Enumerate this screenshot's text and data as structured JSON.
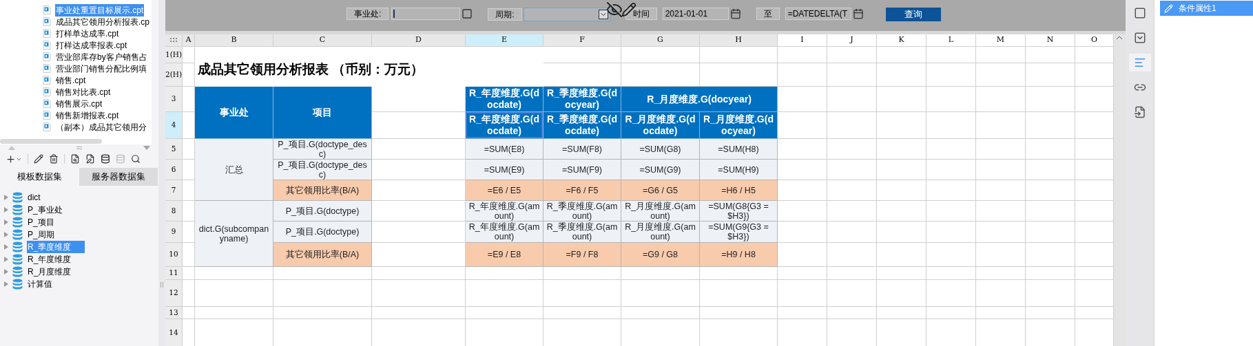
{
  "file_tree": {
    "items": [
      {
        "label": "事业处重置目标展示.cpt",
        "selected": true
      },
      {
        "label": "成品其它领用分析报表.cp",
        "selected": false
      },
      {
        "label": "打样单达成率.cpt",
        "selected": false
      },
      {
        "label": "打样达成率报表.cpt",
        "selected": false
      },
      {
        "label": "营业部库存by客户销售占",
        "selected": false
      },
      {
        "label": "营业部门销售分配比例填",
        "selected": false
      },
      {
        "label": "销售.cpt",
        "selected": false
      },
      {
        "label": "销售对比表.cpt",
        "selected": false
      },
      {
        "label": "销售展示.cpt",
        "selected": false
      },
      {
        "label": "销售新增报表.cpt",
        "selected": false
      },
      {
        "label": "（副本）成品其它领用分",
        "selected": false
      }
    ]
  },
  "dataset_tabs": [
    {
      "label": "模板数据集",
      "selected": true
    },
    {
      "label": "服务器数据集",
      "selected": false
    }
  ],
  "datasets": [
    {
      "label": "dict",
      "selected": false
    },
    {
      "label": "P_事业处",
      "selected": false
    },
    {
      "label": "P_项目",
      "selected": false
    },
    {
      "label": "P_周期",
      "selected": false
    },
    {
      "label": "R_季度维度",
      "selected": true
    },
    {
      "label": "R_年度维度",
      "selected": false
    },
    {
      "label": "R_月度维度",
      "selected": false
    },
    {
      "label": "计算值",
      "selected": false
    }
  ],
  "parameter_pane": {
    "fields": [
      {
        "label": "事业处:",
        "kind": "text"
      },
      {
        "label": "周期:",
        "kind": "dropdown"
      },
      {
        "label": "时间",
        "kind": "date",
        "value": "2021-01-01"
      },
      {
        "label": "至",
        "kind": "date",
        "value": "=DATEDELTA(T"
      }
    ],
    "query_button": "查询"
  },
  "sheet": {
    "columns": [
      {
        "label": "A",
        "selected": false
      },
      {
        "label": "B",
        "selected": false
      },
      {
        "label": "C",
        "selected": false
      },
      {
        "label": "D",
        "selected": false
      },
      {
        "label": "E",
        "selected": true
      },
      {
        "label": "F",
        "selected": false
      },
      {
        "label": "G",
        "selected": false
      },
      {
        "label": "H",
        "selected": false
      },
      {
        "label": "I",
        "selected": false
      },
      {
        "label": "J",
        "selected": false
      },
      {
        "label": "K",
        "selected": false
      },
      {
        "label": "L",
        "selected": false
      },
      {
        "label": "M",
        "selected": false
      },
      {
        "label": "N",
        "selected": false
      },
      {
        "label": "O",
        "selected": false
      }
    ],
    "rows": [
      {
        "label": "1(H)",
        "selected": false
      },
      {
        "label": "2(H)",
        "selected": false
      },
      {
        "label": "3",
        "selected": false
      },
      {
        "label": "4",
        "selected": true
      },
      {
        "label": "5",
        "selected": false
      },
      {
        "label": "6",
        "selected": false
      },
      {
        "label": "7",
        "selected": false
      },
      {
        "label": "8",
        "selected": false
      },
      {
        "label": "9",
        "selected": false
      },
      {
        "label": "10",
        "selected": false
      },
      {
        "label": "11",
        "selected": false
      },
      {
        "label": "12",
        "selected": false
      },
      {
        "label": "13",
        "selected": false
      },
      {
        "label": "14",
        "selected": false
      }
    ],
    "cells": [
      {
        "text": "成品其它领用分析报表 （币别：万元）",
        "kind": "title",
        "selected": false
      },
      {
        "text": "事业处",
        "kind": "header",
        "selected": false
      },
      {
        "text": "项目",
        "kind": "header",
        "selected": false
      },
      {
        "text": "R_年度维度.G(docdate)",
        "kind": "header",
        "selected": false
      },
      {
        "text": "R_季度维度.G(docyear)",
        "kind": "header",
        "selected": false
      },
      {
        "text": "R_月度维度.G(docyear)",
        "kind": "header",
        "selected": false
      },
      {
        "text": "R_年度维度.G(docdate)",
        "kind": "header",
        "selected": true
      },
      {
        "text": "R_季度维度.G(docdate)",
        "kind": "header",
        "selected": false
      },
      {
        "text": "R_月度维度.G(docdate)",
        "kind": "header",
        "selected": false
      },
      {
        "text": "R_月度维度.G(docyear)",
        "kind": "header",
        "selected": false
      },
      {
        "text": "汇总",
        "kind": "body",
        "selected": false
      },
      {
        "text": "P_项目.G(doctype_desc)",
        "kind": "body",
        "selected": false
      },
      {
        "text": "=SUM(E8)",
        "kind": "body",
        "selected": false
      },
      {
        "text": "=SUM(F8)",
        "kind": "body",
        "selected": false
      },
      {
        "text": "=SUM(G8)",
        "kind": "body",
        "selected": false
      },
      {
        "text": "=SUM(H8)",
        "kind": "body",
        "selected": false
      },
      {
        "text": "P_项目.G(doctype_desc)",
        "kind": "body",
        "selected": false
      },
      {
        "text": "=SUM(E9)",
        "kind": "body",
        "selected": false
      },
      {
        "text": "=SUM(F9)",
        "kind": "body",
        "selected": false
      },
      {
        "text": "=SUM(G9)",
        "kind": "body",
        "selected": false
      },
      {
        "text": "=SUM(H9)",
        "kind": "body",
        "selected": false
      },
      {
        "text": "其它领用比率(B/A)",
        "kind": "ratio",
        "selected": false
      },
      {
        "text": "=E6 / E5",
        "kind": "ratio",
        "selected": false
      },
      {
        "text": "=F6 / F5",
        "kind": "ratio",
        "selected": false
      },
      {
        "text": "=G6 / G5",
        "kind": "ratio",
        "selected": false
      },
      {
        "text": "=H6 / H5",
        "kind": "ratio",
        "selected": false
      },
      {
        "text": "dict.G(subcompanyname)",
        "kind": "body",
        "selected": false
      },
      {
        "text": "P_项目.G(doctype)",
        "kind": "body",
        "selected": false
      },
      {
        "text": "R_年度维度.G(amount)",
        "kind": "body",
        "selected": false
      },
      {
        "text": "R_季度维度.G(amount)",
        "kind": "body",
        "selected": false
      },
      {
        "text": "R_月度维度.G(amount)",
        "kind": "body",
        "selected": false
      },
      {
        "text": "=SUM(G8{G3 = $H3})",
        "kind": "body",
        "selected": false
      },
      {
        "text": "P_项目.G(doctype)",
        "kind": "body",
        "selected": false
      },
      {
        "text": "R_年度维度.G(amount)",
        "kind": "body",
        "selected": false
      },
      {
        "text": "R_季度维度.G(amount)",
        "kind": "body",
        "selected": false
      },
      {
        "text": "R_月度维度.G(amount)",
        "kind": "body",
        "selected": false
      },
      {
        "text": "=SUM(G9{G3 = $H3})",
        "kind": "body",
        "selected": false
      },
      {
        "text": "其它领用比率(B/A)",
        "kind": "ratio",
        "selected": false
      },
      {
        "text": "=E9 / E8",
        "kind": "ratio",
        "selected": false
      },
      {
        "text": "=F9 / F8",
        "kind": "ratio",
        "selected": false
      },
      {
        "text": "=G9 / G8",
        "kind": "ratio",
        "selected": false
      },
      {
        "text": "=H9 / H8",
        "kind": "ratio",
        "selected": false
      }
    ]
  },
  "side_tools": [
    {
      "kind": "frame",
      "selected": false
    },
    {
      "kind": "dropdown",
      "selected": false
    },
    {
      "kind": "condition",
      "selected": true
    },
    {
      "kind": "link",
      "selected": false
    },
    {
      "kind": "import",
      "selected": false
    }
  ],
  "right_panel": {
    "items": [
      {
        "label": "条件属性1",
        "selected": true
      }
    ]
  }
}
